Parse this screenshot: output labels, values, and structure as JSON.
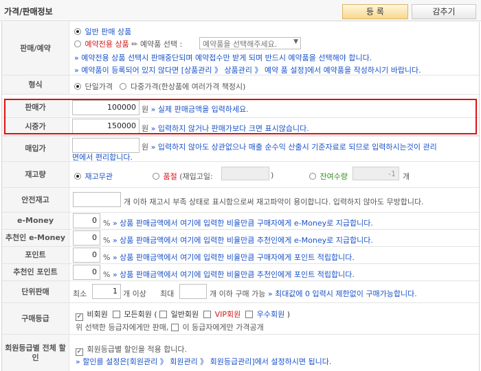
{
  "header": {
    "title": "가격/판매정보",
    "register_label": "등 록",
    "hide_label": "감추기"
  },
  "sale_type": {
    "label": "판매/예약",
    "normal_option": "일반 판매 상품",
    "reserve_option": "예약전용 상품",
    "reserve_select_prefix": "예약품 선택 :",
    "reserve_select_value": "예약품을 선택해주세요.",
    "note1": "» 예약전용 상품 선택시 판매중단되며 예약접수만 받게 되며 반드시 예약품을 선택해야 합니다.",
    "note2": "» 예약품이 등록되어 있지 않다면 [상품관리 》 상품관리 》 예약 품 설정]에서 예약품을 작성하시기 바랍니다."
  },
  "price_form": {
    "label": "형식",
    "single_option": "단일가격",
    "multi_option": "다중가격(한상품에 여러가격 책정시)"
  },
  "sale_price": {
    "label": "판매가",
    "value": "100000",
    "unit": "원",
    "note": "» 실제 판매금액을 입력하세요."
  },
  "market_price": {
    "label": "시중가",
    "value": "150000",
    "unit": "원",
    "note": "» 입력하지 않거나 판매가보다 크면 표시않습니다."
  },
  "purchase_price": {
    "label": "매입가",
    "value": "",
    "unit": "원",
    "note_line1": "» 입력하지 않아도 상관없으나 매출 순수익 산출시 기준자료로 되므로 입력하시는것이 관리",
    "note_line2": "면에서 편리합니다."
  },
  "stock": {
    "label": "재고량",
    "unlimited_option": "재고무관",
    "soldout_option": "품절",
    "restock_prefix": "(재입고일:",
    "restock_suffix": ")",
    "remain_option": "잔여수량",
    "remain_value": "-1",
    "unit": "개"
  },
  "safety_stock": {
    "label": "안전재고",
    "value": "",
    "note": "개 이하 재고시 부족 상태로 표시함으로써 재고파악이 용이합니다. 입력하지 않아도 무방합니다."
  },
  "emoney": {
    "label": "e-Money",
    "value": "0",
    "unit": "%",
    "note": "» 상품 판매금액에서 여기에 입력한 비율만큼 구매자에게 e-Money로 지급합니다."
  },
  "referrer_emoney": {
    "label": "추천인 e-Money",
    "value": "0",
    "unit": "%",
    "note": "» 상품 판매금액에서 여기에 입력한 비율만큼 추천인에게 e-Money로 지급합니다."
  },
  "points": {
    "label": "포인트",
    "value": "0",
    "unit": "%",
    "note": "» 상품 판매금액에서 여기에 입력한 비율만큼 구매자에게 포인트 적립합니다."
  },
  "referrer_points": {
    "label": "추천인 포인트",
    "value": "0",
    "unit": "%",
    "note": "» 상품 판매금액에서 여기에 입력한 비율만큼 추천인에게 포인트 적립합니다."
  },
  "purchase_unit": {
    "label": "단위판매",
    "min_prefix": "최소",
    "min_value": "1",
    "min_suffix": "개 이상",
    "max_prefix": "최대",
    "max_value": "",
    "max_suffix": "개 이하 구매 가능",
    "note": "» 최대값에 0 입력시 제한없이 구매가능합니다."
  },
  "member_level": {
    "label": "구매등급",
    "nonmember": "비회원",
    "all_members": "모든회원 (",
    "general": "일반회원",
    "vip": "VIP회원",
    "excellent": "우수회원",
    "close_paren": ")",
    "line2_prefix": "위 선택한 등급자에게만 판매,",
    "line2_option": "이 등급자에게만 가격공개"
  },
  "member_discount": {
    "label": "회원등급별 전체 할인",
    "option": "회원등급별 할인을 적용 합니다.",
    "note": "» 할인를 설정은[회원관리 》 회원관리 》 회원등급관리]에서 설정하시면 됩니다."
  }
}
